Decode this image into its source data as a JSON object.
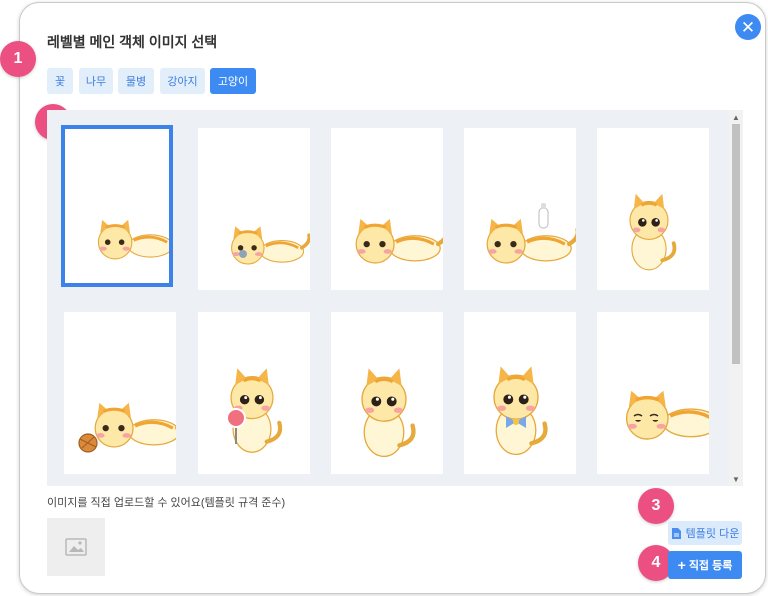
{
  "dialog": {
    "title": "레벨별 메인 객체 이미지 선택",
    "close_icon": "close-icon",
    "accent_color": "#3d8bf2"
  },
  "markers": [
    "1",
    "2",
    "3",
    "4"
  ],
  "tabs": [
    {
      "label": "꽃",
      "active": false
    },
    {
      "label": "나무",
      "active": false
    },
    {
      "label": "물병",
      "active": false
    },
    {
      "label": "강아지",
      "active": false
    },
    {
      "label": "고양이",
      "active": true
    }
  ],
  "images": [
    {
      "subject": "cat-lying-down",
      "selected": true
    },
    {
      "subject": "cat-lying-with-pacifier",
      "selected": false
    },
    {
      "subject": "cat-lying-down",
      "selected": false
    },
    {
      "subject": "cat-lying-with-milk-bottle",
      "selected": false
    },
    {
      "subject": "cat-sitting",
      "selected": false
    },
    {
      "subject": "cat-playing-with-yarn-ball",
      "selected": false
    },
    {
      "subject": "cat-with-lollipop",
      "selected": false
    },
    {
      "subject": "cat-sitting-front",
      "selected": false
    },
    {
      "subject": "cat-with-bow-tie",
      "selected": false
    },
    {
      "subject": "cat-sleeping",
      "selected": false
    }
  ],
  "upload": {
    "label": "이미지를 직접 업로드할 수 있어요(템플릿 규격 준수)",
    "placeholder_icon": "image-placeholder-icon"
  },
  "buttons": {
    "template_download": "템플릿 다운",
    "template_icon": "file-icon",
    "direct_register": "직접 등록",
    "register_icon": "plus-icon"
  },
  "marker_color": "#ec4f82"
}
